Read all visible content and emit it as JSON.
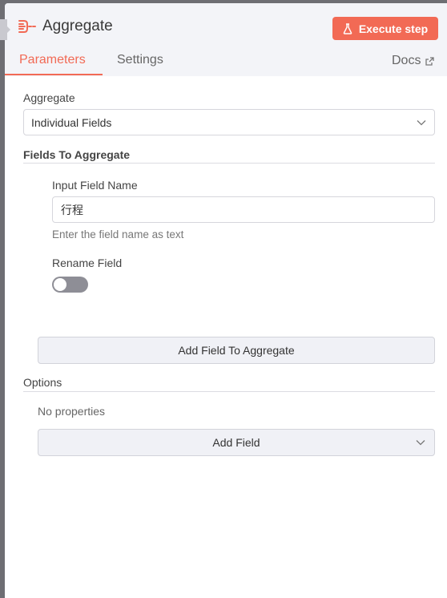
{
  "header": {
    "title": "Aggregate",
    "execute_label": "Execute step",
    "tabs": [
      {
        "label": "Parameters",
        "active": true
      },
      {
        "label": "Settings",
        "active": false
      }
    ],
    "docs_label": "Docs"
  },
  "parameters": {
    "aggregate_label": "Aggregate",
    "aggregate_value": "Individual Fields",
    "fields_section_title": "Fields To Aggregate",
    "input_field_label": "Input Field Name",
    "input_field_value": "行程",
    "input_field_hint": "Enter the field name as text",
    "rename_field_label": "Rename Field",
    "rename_field_on": false,
    "add_field_to_aggregate_label": "Add Field To Aggregate"
  },
  "options": {
    "section_title": "Options",
    "empty_text": "No properties",
    "add_field_label": "Add Field"
  },
  "colors": {
    "accent": "#f26a55",
    "header_bg": "#f3f4f8",
    "toggle_off": "#8e8e96"
  },
  "icons": {
    "node": "aggregate-node-icon",
    "execute": "flask-icon",
    "docs": "external-link-icon",
    "dropdown": "chevron-down-icon"
  }
}
